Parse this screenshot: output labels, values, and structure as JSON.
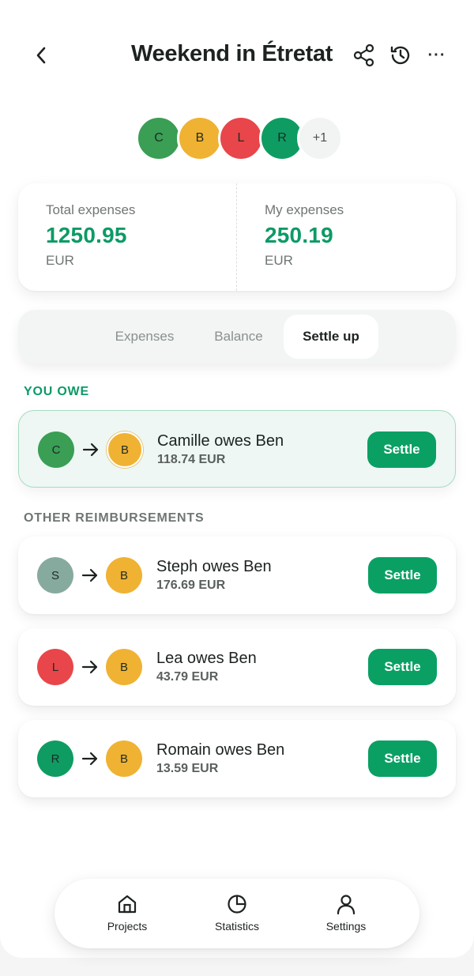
{
  "header": {
    "title": "Weekend in Étretat",
    "back_icon": "chevron-left-icon",
    "share_icon": "share-icon",
    "history_icon": "history-icon",
    "more_label": "···"
  },
  "participants": [
    {
      "initial": "C",
      "color": "#3a9e55"
    },
    {
      "initial": "B",
      "color": "#f0b232"
    },
    {
      "initial": "L",
      "color": "#e8464a"
    },
    {
      "initial": "R",
      "color": "#0e9c62"
    }
  ],
  "participants_more": "+1",
  "summary": {
    "total_label": "Total expenses",
    "total_value": "1250.95",
    "total_unit": "EUR",
    "mine_label": "My expenses",
    "mine_value": "250.19",
    "mine_unit": "EUR"
  },
  "tabs": [
    {
      "label": "Expenses",
      "active": false
    },
    {
      "label": "Balance",
      "active": false
    },
    {
      "label": "Settle up",
      "active": true
    }
  ],
  "you_owe": {
    "label": "YOU OWE",
    "items": [
      {
        "from": "C",
        "from_color": "#3a9e55",
        "to": "B",
        "to_color": "#f0b232",
        "text": "Camille owes Ben",
        "amount": "118.74 EUR",
        "button": "Settle"
      }
    ]
  },
  "others": {
    "label": "OTHER REIMBURSEMENTS",
    "items": [
      {
        "from": "S",
        "from_color": "#86ab9e",
        "to": "B",
        "to_color": "#f0b232",
        "text": "Steph owes Ben",
        "amount": "176.69 EUR",
        "button": "Settle"
      },
      {
        "from": "L",
        "from_color": "#e8464a",
        "to": "B",
        "to_color": "#f0b232",
        "text": "Lea owes Ben",
        "amount": "43.79 EUR",
        "button": "Settle"
      },
      {
        "from": "R",
        "from_color": "#0e9c62",
        "to": "B",
        "to_color": "#f0b232",
        "text": "Romain owes Ben",
        "amount": "13.59 EUR",
        "button": "Settle"
      }
    ]
  },
  "nav": [
    {
      "label": "Projects",
      "icon": "home-icon"
    },
    {
      "label": "Statistics",
      "icon": "pie-chart-icon"
    },
    {
      "label": "Settings",
      "icon": "user-icon"
    }
  ],
  "colors": {
    "accent": "#0aa064",
    "accent_text": "#0c9a66"
  }
}
